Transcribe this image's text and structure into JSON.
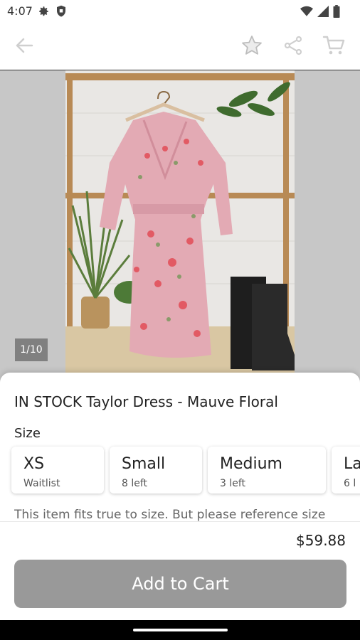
{
  "status_bar": {
    "time": "4:07",
    "icons": [
      "gear-icon",
      "shield-icon",
      "wifi-icon",
      "signal-icon",
      "battery-icon"
    ]
  },
  "toolbar": {
    "icons": [
      "back-arrow-icon",
      "star-icon",
      "share-icon",
      "cart-icon"
    ],
    "icon_color": "#cfcfcf"
  },
  "gallery": {
    "counter": "1/10",
    "background": "#c7c7c7"
  },
  "product": {
    "title": "IN STOCK Taylor Dress - Mauve Floral",
    "size_label": "Size",
    "sizes": [
      {
        "name": "XS",
        "stock": "Waitlist"
      },
      {
        "name": "Small",
        "stock": "8 left"
      },
      {
        "name": "Medium",
        "stock": "3 left"
      },
      {
        "name": "La",
        "stock": "6 l"
      }
    ],
    "description": "This item fits true to size. But please reference size",
    "price": "$59.88",
    "add_to_cart_label": "Add to Cart",
    "button_color": "#999999"
  }
}
